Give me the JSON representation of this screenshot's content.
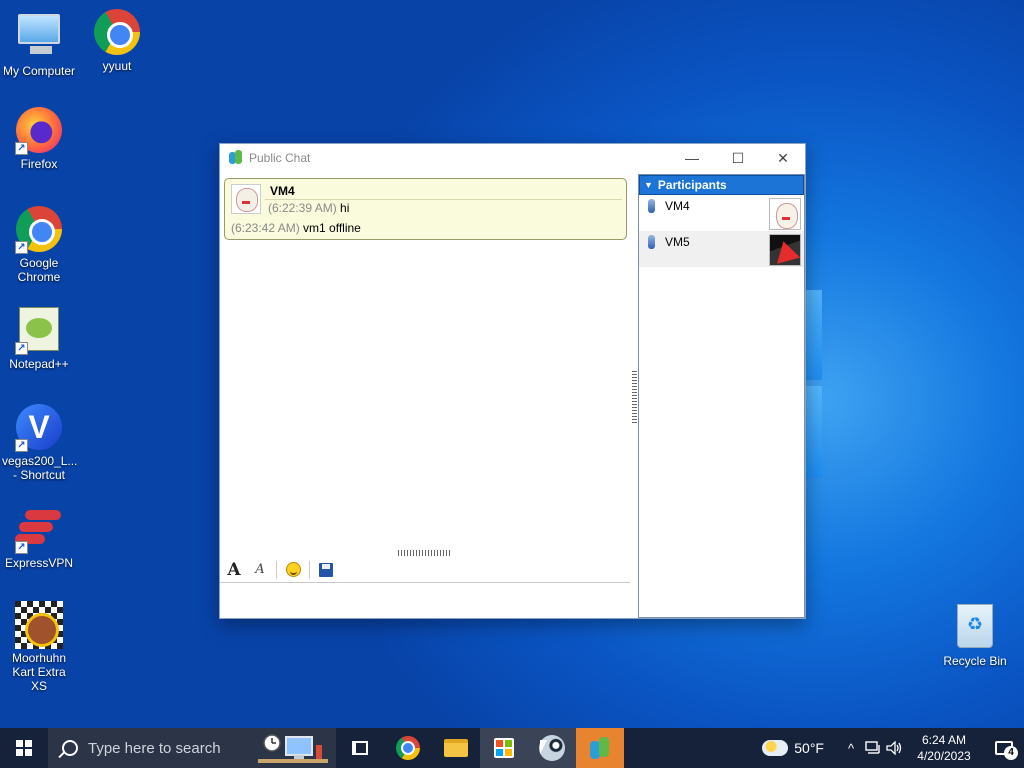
{
  "desktop": {
    "icons": [
      {
        "label": "My Computer"
      },
      {
        "label": "yyuut"
      },
      {
        "label": "Firefox"
      },
      {
        "label": "Google Chrome"
      },
      {
        "label": "Notepad++"
      },
      {
        "label": "vegas200_L... - Shortcut"
      },
      {
        "label": "ExpressVPN"
      },
      {
        "label": "Moorhuhn Kart Extra XS"
      },
      {
        "label": "Recycle Bin"
      }
    ]
  },
  "window": {
    "title": "Public Chat",
    "minimize_glyph": "—",
    "maximize_glyph": "☐",
    "close_glyph": "✕",
    "messages": {
      "sender": "VM4",
      "line1_time": "(6:22:39 AM)",
      "line1_text": "hi",
      "line2_time": "(6:23:42 AM)",
      "line2_text": "vm1 offline"
    },
    "toolbar": {
      "font_glyph": "A",
      "font_style_glyph": "A"
    },
    "participants": {
      "header": "Participants",
      "items": [
        {
          "name": "VM4"
        },
        {
          "name": "VM5"
        }
      ]
    }
  },
  "taskbar": {
    "search_placeholder": "Type here to search",
    "weather_temp": "50°F",
    "time": "6:24 AM",
    "date": "4/20/2023",
    "notification_count": "4",
    "tray_arrow": "^"
  },
  "colors": {
    "accent": "#1b74d6",
    "bubble_bg": "#fafadc",
    "active_app": "#e8842f"
  }
}
